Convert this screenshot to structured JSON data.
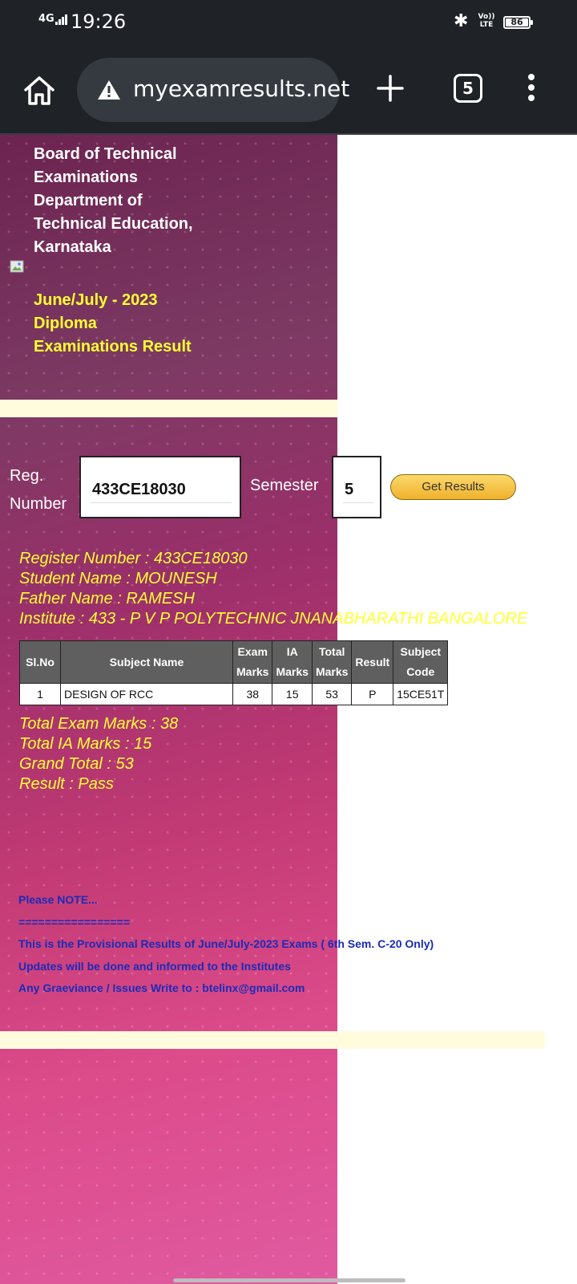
{
  "status_bar": {
    "network": "4G",
    "time": "19:26",
    "volte": "Vo)) LTE",
    "battery": "86"
  },
  "browser": {
    "url": "myexamresults.net",
    "tab_count": "5"
  },
  "header": {
    "title": "Board of Technical Examinations Department of Technical Education, Karnataka",
    "exam": "June/July - 2023 Diploma Examinations Result"
  },
  "form": {
    "reg_label_line1": "Reg.",
    "reg_label_line2": "Number",
    "reg_value": "433CE18030",
    "semester_label": "Semester",
    "semester_value": "5",
    "button_label": "Get Results"
  },
  "student": {
    "register_number": "Register Number : 433CE18030",
    "student_name": "Student Name : MOUNESH",
    "father_name": "Father Name : RAMESH",
    "institute": "Institute : 433 - P V P POLYTECHNIC JNANABHARATHI BANGALORE"
  },
  "table": {
    "headers": {
      "slno": "Sl.No",
      "subject_name": "Subject Name",
      "exam_marks_1": "Exam",
      "exam_marks_2": "Marks",
      "ia_marks_1": "IA",
      "ia_marks_2": "Marks",
      "total_marks_1": "Total",
      "total_marks_2": "Marks",
      "result": "Result",
      "subject_code_1": "Subject",
      "subject_code_2": "Code"
    },
    "rows": [
      {
        "slno": "1",
        "subject_name": "DESIGN OF RCC",
        "exam_marks": "38",
        "ia_marks": "15",
        "total_marks": "53",
        "result": "P",
        "subject_code": "15CE51T"
      }
    ]
  },
  "totals": {
    "total_exam": "Total Exam Marks : 38",
    "total_ia": "Total IA Marks : 15",
    "grand_total": "Grand Total : 53",
    "result": "Result : Pass"
  },
  "note": {
    "line1": "Please NOTE...",
    "line2": "=================",
    "line3": "This is the Provisional Results of June/July-2023 Exams ( 6th Sem. C-20 Only)",
    "line4": "Updates will be done and informed to the Institutes",
    "line5": "Any Graeviance / Issues Write to : btelinx@gmail.com"
  },
  "colors": {
    "info_text": "#ffff33",
    "note_text": "#1b2bb8",
    "strip": "#fffbdd",
    "button": "#f0b02c"
  }
}
